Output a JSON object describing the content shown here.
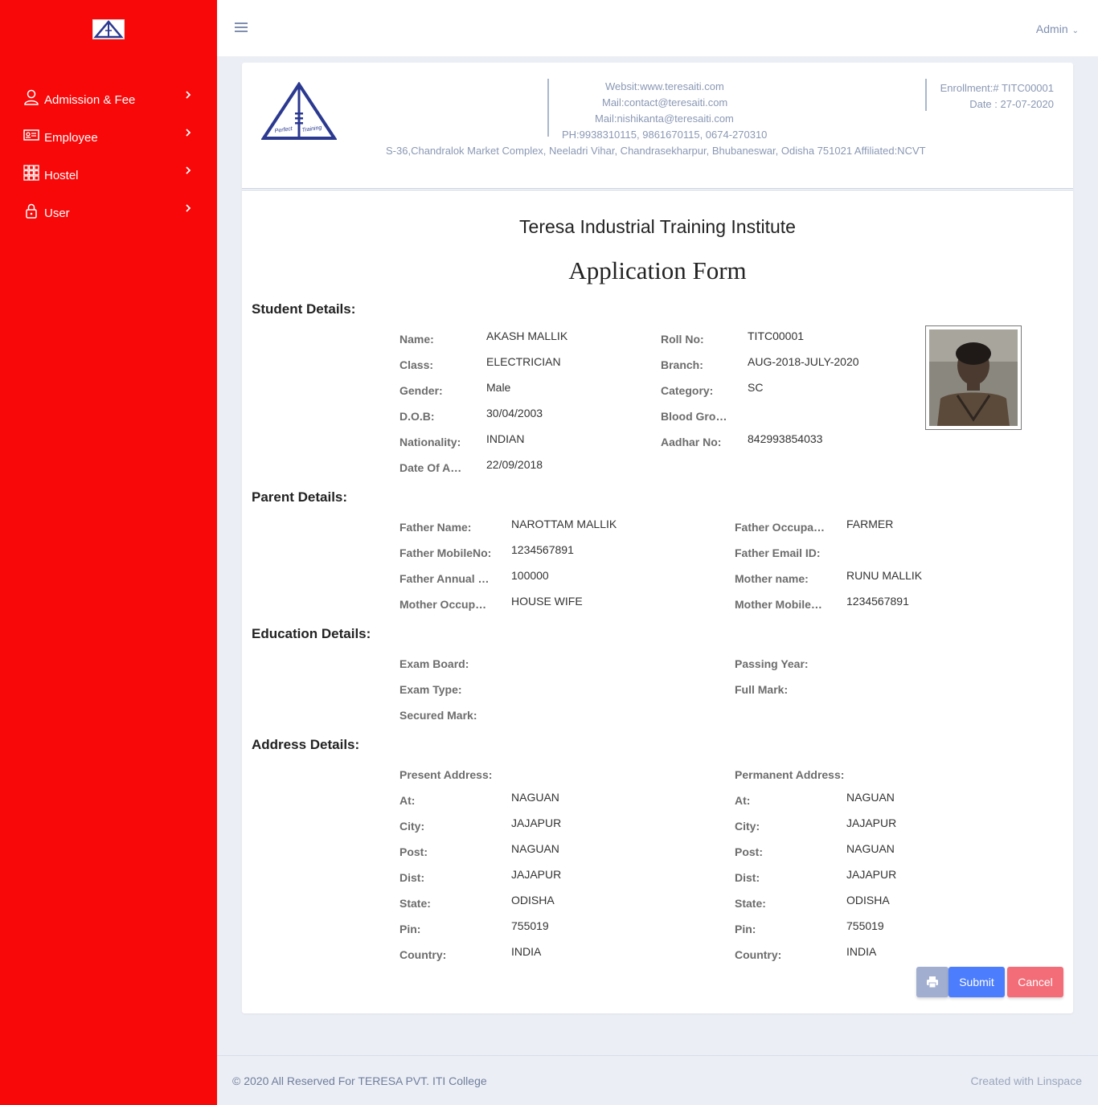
{
  "sidebar": {
    "items": [
      {
        "label": "Admission & Fee",
        "icon": "user-icon"
      },
      {
        "label": "Employee",
        "icon": "id-card-icon"
      },
      {
        "label": "Hostel",
        "icon": "grid-icon"
      },
      {
        "label": "User",
        "icon": "lock-icon"
      }
    ]
  },
  "topbar": {
    "user_label": "Admin"
  },
  "header": {
    "website": "Websit:www.teresaiti.com",
    "mail1": "Mail:contact@teresaiti.com",
    "mail2": "Mail:nishikanta@teresaiti.com",
    "phone": "PH:9938310115, 9861670115, 0674-270310",
    "address": "S-36,Chandralok Market Complex, Neeladri Vihar, Chandrasekharpur, Bhubaneswar, Odisha 751021  Affiliated:NCVT",
    "enrollment": "Enrollment:# TITC00001",
    "date": "Date : 27-07-2020",
    "logo_text": "Perfect Training"
  },
  "institute_name": "Teresa Industrial Training Institute",
  "form_title": "Application Form",
  "student": {
    "heading": "Student Details:",
    "name_label": "Name:",
    "name": "AKASH MALLIK",
    "class_label": "Class:",
    "class": "ELECTRICIAN",
    "gender_label": "Gender:",
    "gender": "Male",
    "dob_label": "D.O.B:",
    "dob": "30/04/2003",
    "nationality_label": "Nationality:",
    "nationality": "INDIAN",
    "doa_label": "Date Of Admission:",
    "doa": "22/09/2018",
    "roll_label": "Roll No:",
    "roll": "TITC00001",
    "branch_label": "Branch:",
    "branch": "AUG-2018-JULY-2020",
    "category_label": "Category:",
    "category": "SC",
    "blood_label": "Blood Group:",
    "blood": "",
    "aadhar_label": "Aadhar No:",
    "aadhar": "842993854033"
  },
  "parent": {
    "heading": "Parent Details:",
    "father_name_label": "Father Name:",
    "father_name": "NAROTTAM MALLIK",
    "father_mobile_label": "Father MobileNo:",
    "father_mobile": "1234567891",
    "father_income_label": "Father Annual Income:",
    "father_income": "100000",
    "mother_occ_label": "Mother Occupation:",
    "mother_occ": "HOUSE WIFE",
    "father_occ_label": "Father Occupation:",
    "father_occ": "FARMER",
    "father_email_label": "Father Email ID:",
    "father_email": "",
    "mother_name_label": "Mother name:",
    "mother_name": "RUNU MALLIK",
    "mother_mobile_label": "Mother MobileNo:",
    "mother_mobile": "1234567891"
  },
  "education": {
    "heading": "Education Details:",
    "board_label": "Exam Board:",
    "type_label": "Exam Type:",
    "secured_label": "Secured Mark:",
    "year_label": "Passing Year:",
    "full_label": "Full Mark:"
  },
  "address": {
    "heading": "Address Details:",
    "present_label": "Present Address:",
    "permanent_label": "Permanent Address:",
    "labels": {
      "at": "At:",
      "city": "City:",
      "post": "Post:",
      "dist": "Dist:",
      "state": "State:",
      "pin": "Pin:",
      "country": "Country:"
    },
    "present": {
      "at": "NAGUAN",
      "city": "JAJAPUR",
      "post": "NAGUAN",
      "dist": "JAJAPUR",
      "state": "ODISHA",
      "pin": "755019",
      "country": "INDIA"
    },
    "permanent": {
      "at": "NAGUAN",
      "city": "JAJAPUR",
      "post": "NAGUAN",
      "dist": "JAJAPUR",
      "state": "ODISHA",
      "pin": "755019",
      "country": "INDIA"
    }
  },
  "buttons": {
    "submit": "Submit",
    "cancel": "Cancel"
  },
  "footer": {
    "copyright": "© 2020 All Reserved For TERESA PVT. ITI College",
    "credit": "Created with Linspace"
  },
  "colors": {
    "sidebar": "#f80808",
    "submit": "#4c7dfc",
    "cancel": "#f26d78",
    "print": "#a1aed0"
  }
}
